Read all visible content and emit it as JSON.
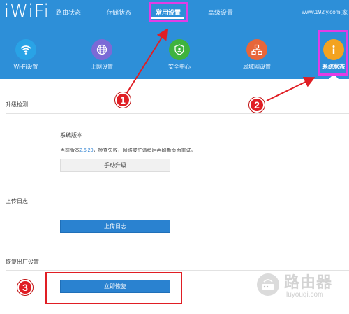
{
  "header": {
    "logo": "iWiFi",
    "nav": [
      "路由状态",
      "存储状态",
      "常用设置",
      "高级设置"
    ],
    "url": "www.192ly.com(家"
  },
  "icons": [
    {
      "label": "Wi-Fi设置",
      "icon": "wifi-icon",
      "color": "#29a3e6"
    },
    {
      "label": "上网设置",
      "icon": "globe-icon",
      "color": "#7b6ad6"
    },
    {
      "label": "安全中心",
      "icon": "shield-icon",
      "color": "#3fb33e"
    },
    {
      "label": "局域网设置",
      "icon": "network-icon",
      "color": "#e7663a"
    },
    {
      "label": "系统状态",
      "icon": "info-icon",
      "color": "#f3a320"
    }
  ],
  "upgrade": {
    "title": "升级检测",
    "version_label": "系统版本",
    "version_prefix": "当前版本",
    "version": "2.6.20",
    "version_suffix": "，检查失败，网络被忙请稍后再刷新页面重试。",
    "button": "手动升级"
  },
  "upload": {
    "title": "上传日志",
    "button": "上传日志"
  },
  "reset": {
    "title": "恢复出厂设置",
    "button": "立即恢复"
  },
  "annotations": [
    "1",
    "2",
    "3"
  ],
  "watermark": {
    "title": "路由器",
    "subtitle": "luyouqi.com"
  }
}
